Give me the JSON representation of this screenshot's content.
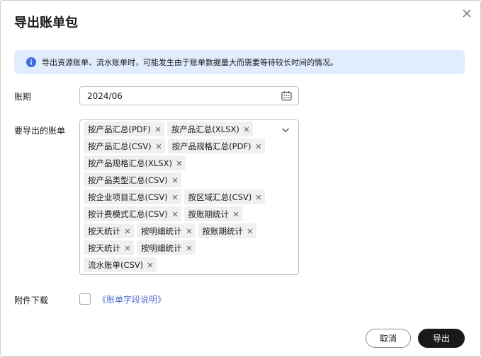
{
  "dialog": {
    "title": "导出账单包",
    "alert": "导出资源账单、流水账单时，可能发生由于账单数据量大而需要等待较长时间的情况。"
  },
  "period": {
    "label": "账期",
    "value": "2024/06"
  },
  "bills": {
    "label": "要导出的账单",
    "tags": [
      "按产品汇总(PDF)",
      "按产品汇总(XLSX)",
      "按产品汇总(CSV)",
      "按产品规格汇总(PDF)",
      "按产品规格汇总(XLSX)",
      "按产品类型汇总(CSV)",
      "按企业项目汇总(CSV)",
      "按区域汇总(CSV)",
      "按计费模式汇总(CSV)",
      "按账期统计",
      "按天统计",
      "按明细统计",
      "按账期统计",
      "按天统计",
      "按明细统计",
      "流水账单(CSV)"
    ]
  },
  "attachment": {
    "label": "附件下载",
    "link": "《账单字段说明》",
    "checked": false
  },
  "footer": {
    "cancel": "取消",
    "export": "导出"
  },
  "colors": {
    "alert_bg": "#e1ecfd",
    "info_icon": "#3b6fe0",
    "link": "#526ecc",
    "primary_button": "#191919"
  }
}
